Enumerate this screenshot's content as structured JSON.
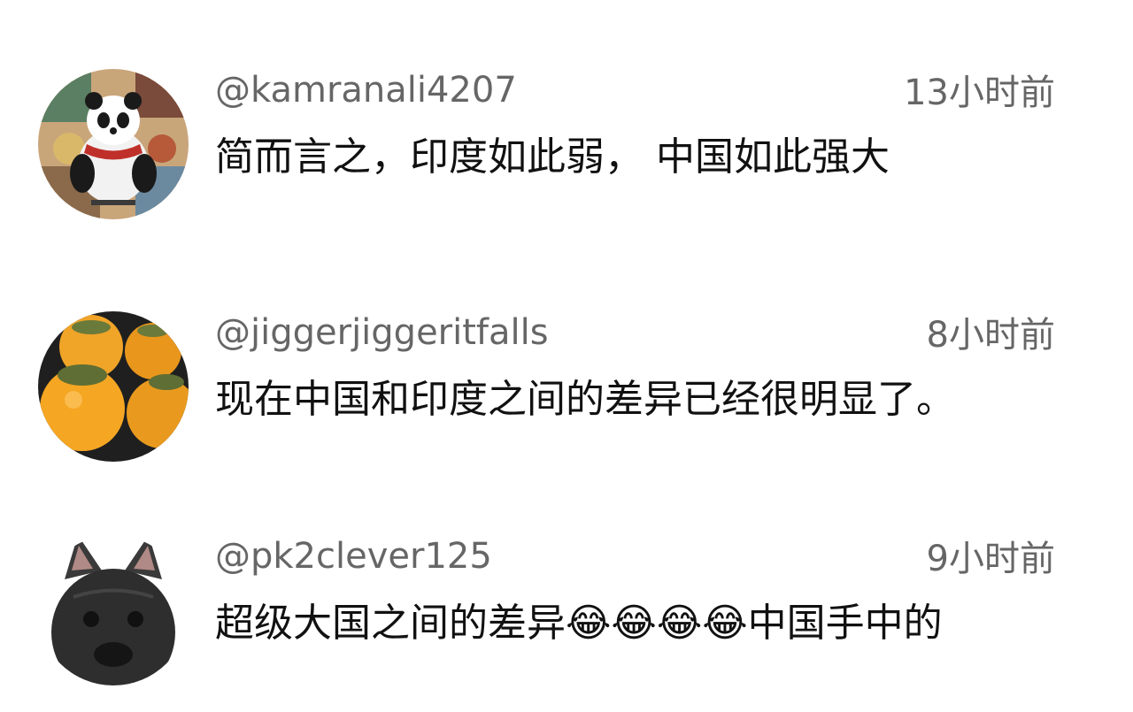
{
  "comments": [
    {
      "username": "@kamranali4207",
      "time": "13小时前",
      "text": "简而言之，印度如此弱， 中国如此强大",
      "avatar_icon": "panda-poster-avatar"
    },
    {
      "username": "@jiggerjiggeritfalls",
      "time": "8小时前",
      "text": "现在中国和印度之间的差异已经很明显了。",
      "avatar_icon": "persimmon-avatar"
    },
    {
      "username": "@pk2clever125",
      "time": "9小时前",
      "text": "超级大国之间的差异😂😂😂😂中国手中的",
      "avatar_icon": "bulldog-avatar"
    }
  ],
  "colors": {
    "meta_text": "#666666",
    "body_text": "#111111",
    "background": "#ffffff"
  }
}
